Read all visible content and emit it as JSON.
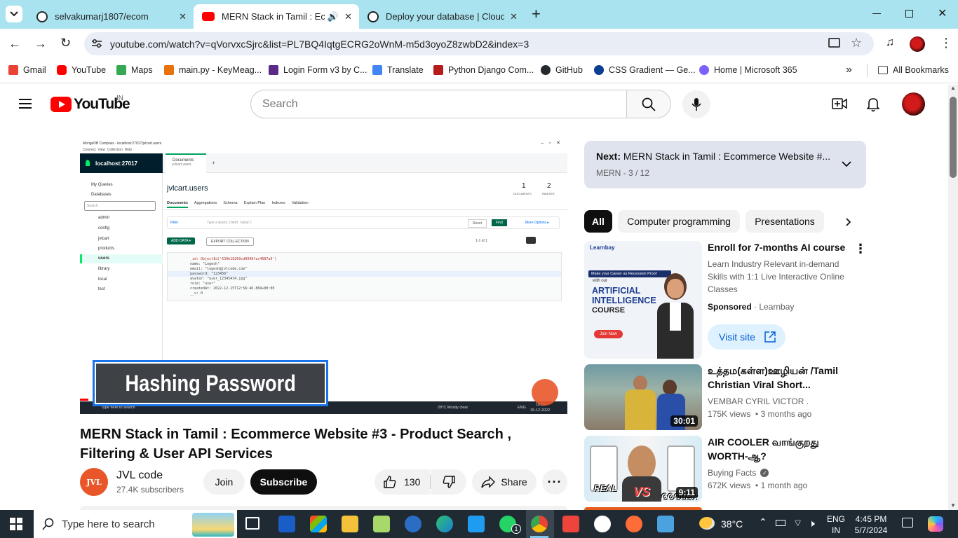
{
  "browser": {
    "tabs": [
      {
        "title": "selvakumarj1807/ecom",
        "favicon_color": "#24292f"
      },
      {
        "title": "MERN Stack in Tamil : Ecom",
        "favicon_color": "#ff0000"
      },
      {
        "title": "Deploy your database | Cloud: I",
        "favicon_color": "#1a73e8"
      }
    ],
    "new_tab_label": "+",
    "url": "youtube.com/watch?v=qVorvxcSjrc&list=PL7BQ4IqtgECRG2oWnM-m5d3oyoZ8zwbD2&index=3",
    "bookmarks": [
      {
        "label": "Gmail",
        "color": "#ea4335"
      },
      {
        "label": "YouTube",
        "color": "#ff0000"
      },
      {
        "label": "Maps",
        "color": "#34a853"
      },
      {
        "label": "main.py - KeyMeag...",
        "color": "#e8710a"
      },
      {
        "label": "Login Form v3 by C...",
        "color": "#5b2a86"
      },
      {
        "label": "Translate",
        "color": "#4285f4"
      },
      {
        "label": "Python Django Com...",
        "color": "#b71c1c"
      },
      {
        "label": "GitHub",
        "color": "#24292f"
      },
      {
        "label": "CSS Gradient — Ge...",
        "color": "#0b3d91"
      },
      {
        "label": "Home | Microsoft 365",
        "color": "#7b61ff"
      }
    ],
    "bookmarks_more": "»",
    "all_bookmarks": "All Bookmarks"
  },
  "youtube": {
    "logo_text": "YouTube",
    "logo_region": "IN",
    "search_placeholder": "Search",
    "video": {
      "title": "MERN Stack in Tamil : Ecommerce Website #3 - Product Search , Filtering & User API Services",
      "overlay_caption": "Hashing Password",
      "channel_name": "JVL code",
      "channel_subs": "27.4K subscribers",
      "join_label": "Join",
      "subscribe_label": "Subscribe",
      "likes": "130",
      "share_label": "Share"
    },
    "compass": {
      "window_title": "MongoDB Compass - localhost:27017/jvlcart.users",
      "host": "localhost:27017",
      "tab_label": "Documents",
      "tab_sub": "jvlcart.users",
      "collection": "jvlcart.users",
      "documents_count": "1",
      "documents_label": "DOCUMENTS",
      "indexes_count": "2",
      "indexes_label": "INDEXES",
      "sub_tabs": [
        "Documents",
        "Aggregations",
        "Schema",
        "Explain Plan",
        "Indexes",
        "Validation"
      ],
      "sidebar": [
        "My Queries",
        "Databases",
        "admin",
        "config",
        "jvlcart",
        "products",
        "users",
        "library",
        "local",
        "test"
      ],
      "filter_label": "Filter",
      "filter_placeholder": "Type a query: { field: 'value' }",
      "reset": "Reset",
      "find": "Find",
      "more_options": "More Options ▸",
      "add_data": "ADD DATA ▾",
      "export": "EXPORT COLLECTION",
      "paging": "1-1 of 1",
      "doc_lines": [
        "_id: ObjectId('639b18269cd0998fac4687a9')",
        "name: \"Logesh\"",
        "email: \"logesh@jvlcode.com\"",
        "password: \"123456\"",
        "avatar: \"user_12345434.jpg\"",
        "role: \"user\"",
        "createdAt: 2022-12-15T12:56:46.869+00:00",
        "__v: 0"
      ],
      "search_bar": "Type here to search",
      "weather": "28°C  Mostly clear",
      "time": "18:29",
      "date": "15-12-2022",
      "lang": "ENG"
    },
    "up_next": {
      "label": "Next:",
      "title": "MERN Stack in Tamil : Ecommerce Website  #...",
      "playlist": "MERN - 3 / 12"
    },
    "chips": [
      "All",
      "Computer programming",
      "Presentations"
    ],
    "ad": {
      "title": "Enroll for 7-months AI course",
      "desc": "Learn Industry Relevant in-demand Skills with 1:1 Live Interactive Online Classes",
      "sponsored": "Sponsored",
      "advertiser": "Learnbay",
      "cta": "Visit site",
      "thumb_brand": "Learnbay",
      "thumb_tag": "Make your Career as Recession Proof",
      "thumb_with": "with our",
      "thumb_line1": "ARTIFICIAL",
      "thumb_line2": "INTELLIGENCE",
      "thumb_line3": "COURSE",
      "thumb_join": "Join Now"
    },
    "recommendations": [
      {
        "title": "உத்தம(கள்ள)ஊழியன் /Tamil Christian Viral Short...",
        "channel": "VEMBAR CYRIL VICTOR .",
        "meta": "175K views  • 3 months ago",
        "duration": "30:01"
      },
      {
        "title": "AIR COOLER வாங்குறது WORTH-ஆ?",
        "channel": "Buying Facts",
        "meta": "672K views  • 1 month ago",
        "duration": "9:11",
        "thumb_text1": "REAL",
        "thumb_text2": "VS",
        "thumb_text3": "COOLER"
      }
    ]
  },
  "taskbar": {
    "search_placeholder": "Type here to search",
    "temperature": "38°C",
    "lang_line1": "ENG",
    "lang_line2": "IN",
    "time": "4:45 PM",
    "date": "5/7/2024",
    "whatsapp_badge": "1"
  }
}
